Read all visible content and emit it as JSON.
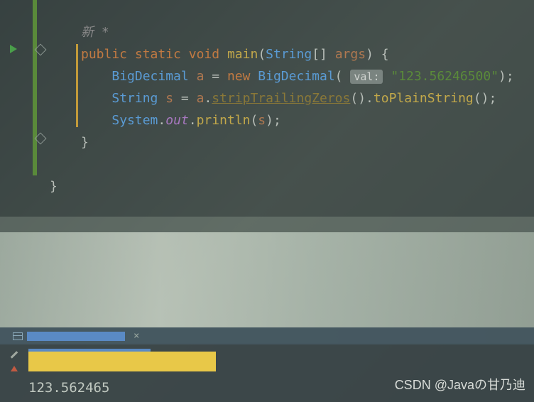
{
  "code": {
    "comment": "新 *",
    "line1": {
      "kw_public": "public",
      "kw_static": "static",
      "kw_void": "void",
      "method_main": "main",
      "type_string": "String",
      "brackets": "[]",
      "param_args": "args",
      "brace": ") {"
    },
    "line2": {
      "type_bigdecimal": "BigDecimal",
      "var_a": "a",
      "eq": " = ",
      "kw_new": "new",
      "ctor": "BigDecimal",
      "hint_val": "val:",
      "str_literal": "\"123.56246500\"",
      "end": ");"
    },
    "line3": {
      "type_string": "String",
      "var_s": "s",
      "eq": " = ",
      "var_a": "a",
      "dot1": ".",
      "method_strip": "stripTrailingZeros",
      "parens1": "()",
      "dot2": ".",
      "method_plain": "toPlainString",
      "parens2": "()",
      "semi": ";"
    },
    "line4": {
      "type_system": "System",
      "dot1": ".",
      "field_out": "out",
      "dot2": ".",
      "method_println": "println",
      "paren_open": "(",
      "var_s": "s",
      "end": ");"
    },
    "close_method": "}",
    "close_class": "}"
  },
  "terminal": {
    "output": "123.562465"
  },
  "watermark": "CSDN @Javaの甘乃迪"
}
